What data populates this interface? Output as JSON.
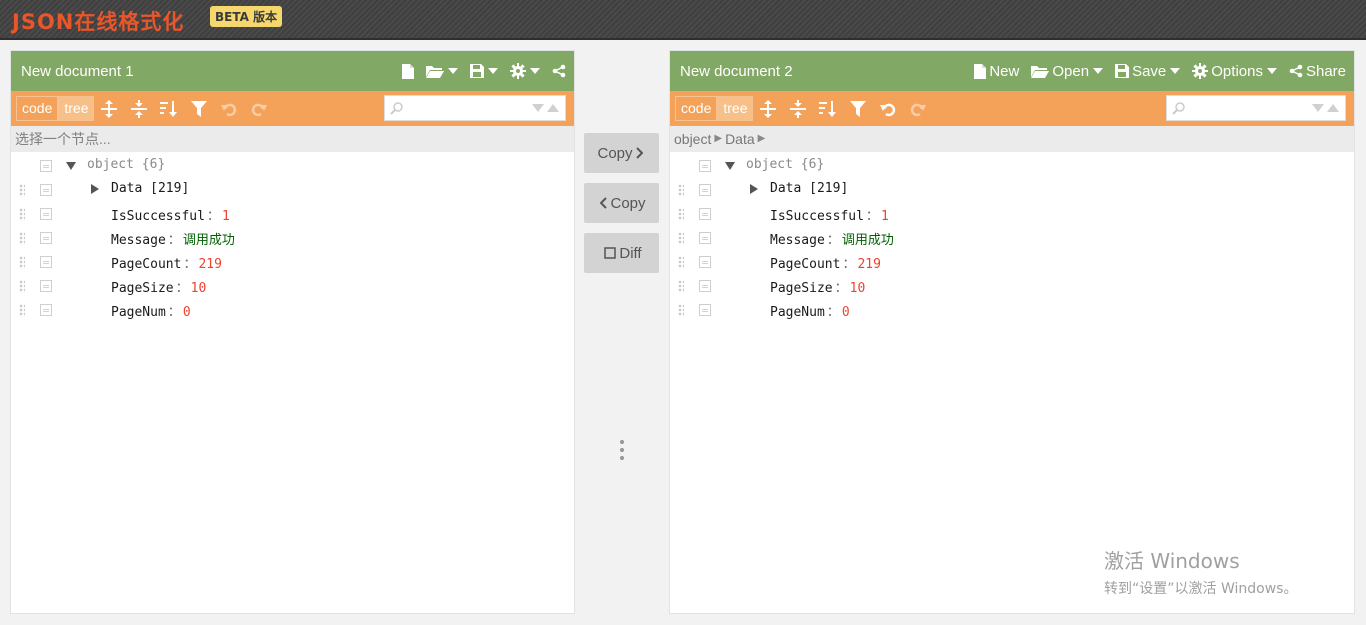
{
  "brand": {
    "title": "JSON在线格式化",
    "badge": "BETA 版本"
  },
  "colors": {
    "menubar": "#82a865",
    "toolbar": "#f4a259",
    "number": "#ee422e",
    "string": "#006000",
    "brand": "#e8562a"
  },
  "left": {
    "title": "New document 1",
    "menu": {
      "icons": [
        "new-file-icon",
        "open-folder-icon",
        "save-icon",
        "settings-gear-icon",
        "share-icon"
      ]
    },
    "modes": {
      "code": "code",
      "tree": "tree"
    },
    "nav_placeholder": "选择一个节点...",
    "tree": {
      "root_label": "object",
      "root_count": "{6}",
      "data_key": "Data",
      "data_count": "[219]",
      "rows": [
        {
          "key": "IsSuccessful",
          "value": "1"
        },
        {
          "key": "Message",
          "value": "调用成功"
        },
        {
          "key": "PageCount",
          "value": "219"
        },
        {
          "key": "PageSize",
          "value": "10"
        },
        {
          "key": "PageNum",
          "value": "0"
        }
      ],
      "separator": "："
    }
  },
  "right": {
    "title": "New document 2",
    "menu": {
      "new": "New",
      "open": "Open",
      "save": "Save",
      "options": "Options",
      "share": "Share"
    },
    "modes": {
      "code": "code",
      "tree": "tree"
    },
    "breadcrumb": [
      "object",
      "Data"
    ],
    "tree": {
      "root_label": "object",
      "root_count": "{6}",
      "data_key": "Data",
      "data_count": "[219]",
      "rows": [
        {
          "key": "IsSuccessful",
          "value": "1"
        },
        {
          "key": "Message",
          "value": "调用成功"
        },
        {
          "key": "PageCount",
          "value": "219"
        },
        {
          "key": "PageSize",
          "value": "10"
        },
        {
          "key": "PageNum",
          "value": "0"
        }
      ],
      "separator": "："
    }
  },
  "middle": {
    "copy_right": "Copy",
    "copy_left": "Copy",
    "diff": "Diff"
  },
  "watermark": {
    "line1": "激活 Windows",
    "line2": "转到“设置”以激活 Windows。"
  }
}
